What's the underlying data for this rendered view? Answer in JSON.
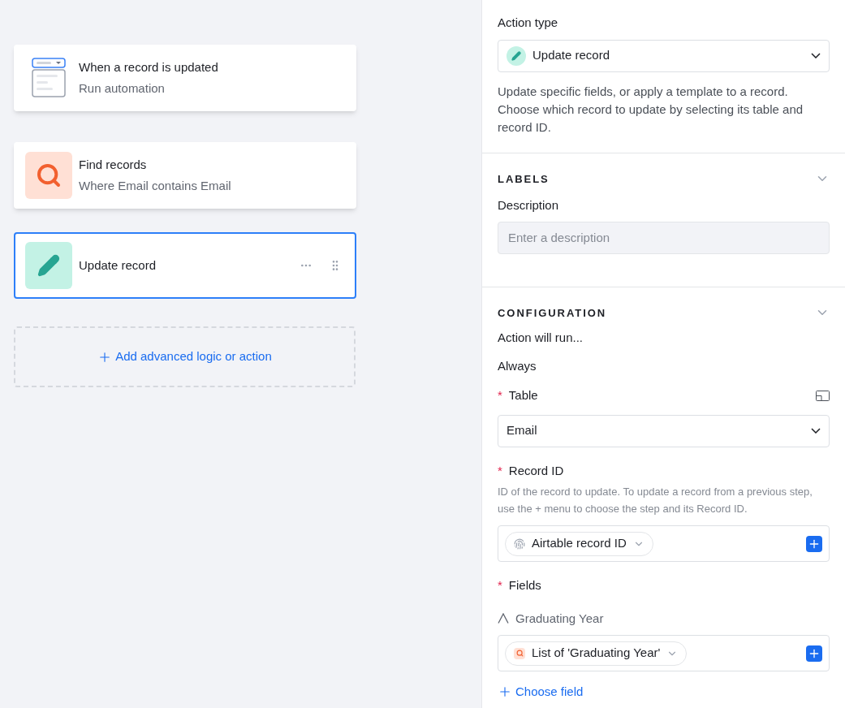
{
  "steps": [
    {
      "kind": "trigger",
      "title": "When a record is updated",
      "subtitle": "Run automation",
      "selected": false
    },
    {
      "kind": "find",
      "title": "Find records",
      "subtitle": "Where Email contains Email",
      "selected": false
    },
    {
      "kind": "update",
      "title": "Update record",
      "selected": true
    }
  ],
  "add_step": {
    "label": "Add advanced logic or action"
  },
  "panel": {
    "action_type": {
      "label": "Action type",
      "value": "Update record",
      "description": "Update specific fields, or apply a template to a record. Choose which record to update by selecting its table and record ID."
    },
    "labels": {
      "heading": "LABELS",
      "expanded": true,
      "description_label": "Description",
      "description_placeholder": "Enter a description"
    },
    "configuration": {
      "heading": "CONFIGURATION",
      "expanded": true,
      "run_label": "Action will run...",
      "run_value": "Always",
      "table": {
        "required_mark": "*",
        "label": "Table",
        "value": "Email"
      },
      "record_id": {
        "required_mark": "*",
        "label": "Record ID",
        "help": "ID of the record to update. To update a record from a previous step, use the + menu to choose the step and its Record ID.",
        "token": "Airtable record ID"
      },
      "fields": {
        "required_mark": "*",
        "label": "Fields",
        "items": [
          {
            "name": "Graduating Year",
            "token": "List of 'Graduating Year'"
          }
        ]
      },
      "choose_field": "Choose field"
    }
  }
}
